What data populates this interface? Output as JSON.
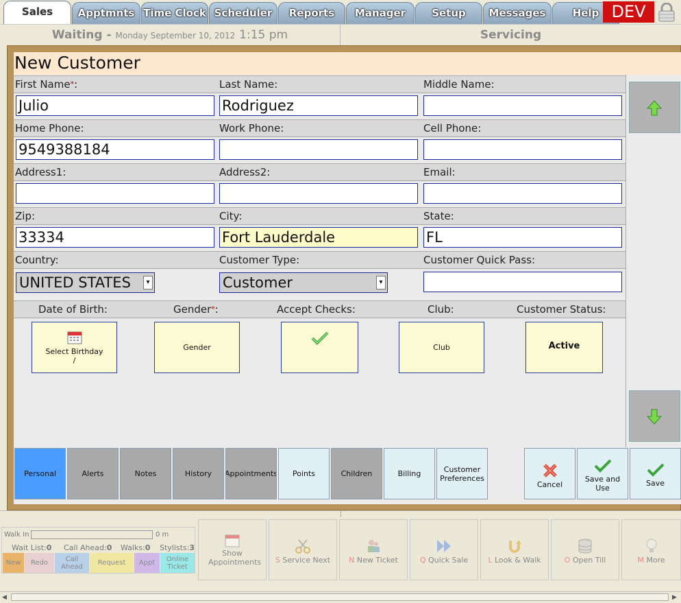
{
  "tabs": [
    {
      "label": "Sales",
      "active": true
    },
    {
      "label": "Apptmnts"
    },
    {
      "label": "Time Clock"
    },
    {
      "label": "Scheduler"
    },
    {
      "label": "Reports"
    },
    {
      "label": "Manager"
    },
    {
      "label": "Setup"
    },
    {
      "label": "Messages"
    },
    {
      "label": "Help"
    }
  ],
  "env_badge": "DEV",
  "status": {
    "waiting": "Waiting -",
    "date": "Monday September 10, 2012",
    "time": "1:15 pm",
    "servicing": "Servicing"
  },
  "title": "New Customer",
  "fields": {
    "first_name": {
      "label": "First Name",
      "value": "Julio"
    },
    "last_name": {
      "label": "Last Name:",
      "value": "Rodriguez"
    },
    "middle_name": {
      "label": "Middle Name:",
      "value": ""
    },
    "home_phone": {
      "label": "Home Phone:",
      "value": "9549388184"
    },
    "work_phone": {
      "label": "Work Phone:",
      "value": ""
    },
    "cell_phone": {
      "label": "Cell Phone:",
      "value": ""
    },
    "address1": {
      "label": "Address1:",
      "value": ""
    },
    "address2": {
      "label": "Address2:",
      "value": ""
    },
    "email": {
      "label": "Email:",
      "value": ""
    },
    "zip": {
      "label": "Zip:",
      "value": "33334"
    },
    "city": {
      "label": "City:",
      "value": "Fort Lauderdale"
    },
    "state": {
      "label": "State:",
      "value": "FL"
    },
    "country": {
      "label": "Country:",
      "value": "UNITED STATES"
    },
    "customer_type": {
      "label": "Customer Type:",
      "value": "Customer"
    },
    "quick_pass": {
      "label": "Customer Quick Pass:",
      "value": ""
    }
  },
  "required_mark": "*",
  "colon": ":",
  "option_labels": {
    "dob": "Date of Birth:",
    "gender": "Gender",
    "accept_checks": "Accept Checks:",
    "club": "Club:",
    "status": "Customer Status:"
  },
  "option_buttons": {
    "birthday": "Select Birthday",
    "birthday_value": "/",
    "gender": "Gender",
    "club": "Club",
    "status": "Active"
  },
  "subtabs": [
    "Personal",
    "Alerts",
    "Notes",
    "History",
    "Appointments",
    "Points",
    "Children",
    "Billing",
    "Customer Preferences"
  ],
  "actions": {
    "cancel": "Cancel",
    "save_use": "Save and Use",
    "save": "Save"
  },
  "walkin": {
    "label": "Walk In",
    "minutes": "0 m",
    "waitlist_label": "Wait List:",
    "waitlist": "0",
    "callahead_label": "Call Ahead:",
    "callahead": "0",
    "walks_label": "Walks:",
    "walks": "0",
    "stylists_label": "Stylists:",
    "stylists": "3"
  },
  "legend": [
    "New",
    "Redo",
    "Call Ahead",
    "Request",
    "Appt",
    "Online Ticket"
  ],
  "quick_buttons": [
    {
      "key": "",
      "label": "Show Appointments"
    },
    {
      "key": "S",
      "label": "Service Next"
    },
    {
      "key": "N",
      "label": "New Ticket"
    },
    {
      "key": "Q",
      "label": "Quick Sale"
    },
    {
      "key": "L",
      "label": "Look & Walk"
    },
    {
      "key": "O",
      "label": "Open Till"
    },
    {
      "key": "M",
      "label": "More"
    }
  ]
}
